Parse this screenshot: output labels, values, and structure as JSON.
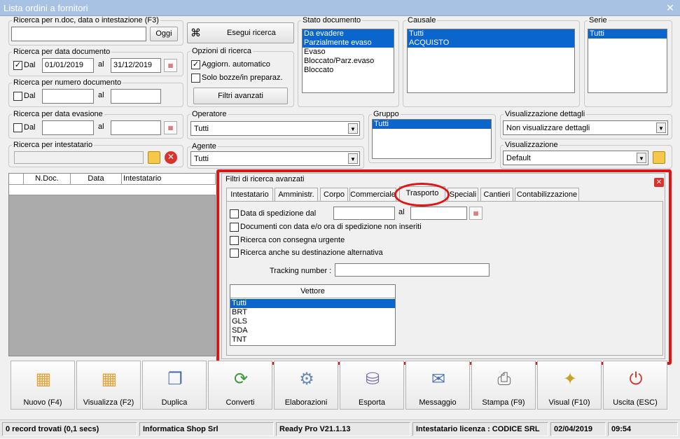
{
  "window": {
    "title": "Lista ordini a fornitori",
    "close": "✕"
  },
  "search": {
    "quick": {
      "legend": "Ricerca per n.doc, data o intestazione (F3)",
      "value": "",
      "go": "Oggi"
    },
    "run": "Esegui ricerca",
    "by_date": {
      "legend": "Ricerca per data documento",
      "enabled": "✓",
      "from_label": "Dal",
      "from": "01/01/2019",
      "to_label": "al",
      "to": "31/12/2019"
    },
    "by_number": {
      "legend": "Ricerca per numero documento",
      "from_label": "Dal",
      "to_label": "al"
    },
    "by_eval": {
      "legend": "Ricerca per data evasione",
      "from_label": "Dal",
      "to_label": "al"
    },
    "by_holder": {
      "legend": "Ricerca per intestatario"
    }
  },
  "options": {
    "legend": "Opzioni di ricerca",
    "auto": "Aggiorn. automatico",
    "auto_checked": "✓",
    "draft": "Solo bozze/in preparaz.",
    "advanced": "Filtri avanzati"
  },
  "status_doc": {
    "legend": "Stato documento",
    "items": [
      "Da evadere",
      "Parzialmente evaso",
      "Evaso",
      "Bloccato/Parz.evaso",
      "Bloccato"
    ]
  },
  "causale": {
    "legend": "Causale",
    "items": [
      "Tutti",
      "ACQUISTO"
    ]
  },
  "serie": {
    "legend": "Serie",
    "items": [
      "Tutti"
    ]
  },
  "operatore": {
    "legend": "Operatore",
    "value": "Tutti"
  },
  "agente": {
    "legend": "Agente",
    "value": "Tutti"
  },
  "gruppo": {
    "legend": "Gruppo",
    "items": [
      "Tutti"
    ]
  },
  "vis_dettagli": {
    "legend": "Visualizzazione dettagli",
    "value": "Non visualizzare dettagli"
  },
  "visualizzazione": {
    "legend": "Visualizzazione",
    "value": "Default"
  },
  "grid": {
    "columns": [
      "N.Doc.",
      "Data",
      "Intestatario"
    ]
  },
  "advanced": {
    "title": "Filtri di ricerca avanzati",
    "close": "✕",
    "tabs": [
      "Intestatario",
      "Amministr.",
      "Corpo",
      "Commerciale",
      "Trasporto",
      "Speciali",
      "Cantieri",
      "Contabilizzazione"
    ],
    "ship_date": "Data di spedizione dal",
    "ship_to": "al",
    "no_ship": "Documenti con data e/o ora di spedizione non inseriti",
    "urgent": "Ricerca con consegna urgente",
    "alt_dest": "Ricerca anche su destinazione alternativa",
    "tracking_label": "Tracking number :",
    "tracking": "",
    "vettore": {
      "header": "Vettore",
      "items": [
        "Tutti",
        "BRT",
        "GLS",
        "SDA",
        "TNT"
      ]
    }
  },
  "toolbar": [
    {
      "label": "Nuovo (F4)",
      "icon": "▦"
    },
    {
      "label": "Visualizza (F2)",
      "icon": "▦"
    },
    {
      "label": "Duplica",
      "icon": "❐"
    },
    {
      "label": "Converti",
      "icon": "⟳"
    },
    {
      "label": "Elaborazioni",
      "icon": "⚙"
    },
    {
      "label": "Esporta",
      "icon": "⛁"
    },
    {
      "label": "Messaggio",
      "icon": "✉"
    },
    {
      "label": "Stampa (F9)",
      "icon": "⎙"
    },
    {
      "label": "Visual (F10)",
      "icon": "✦"
    },
    {
      "label": "Uscita (ESC)",
      "icon": "⏻"
    }
  ],
  "statusbar": {
    "records": "0 record trovati (0,1 secs)",
    "company": "Informatica Shop Srl",
    "version": "Ready Pro V21.1.13",
    "license": "Intestatario licenza : CODICE SRL",
    "date": "02/04/2019",
    "time": "09:54"
  },
  "colors": {
    "highlight": "#e21313",
    "selection": "#0a66cc",
    "exit": "#d9312b"
  }
}
